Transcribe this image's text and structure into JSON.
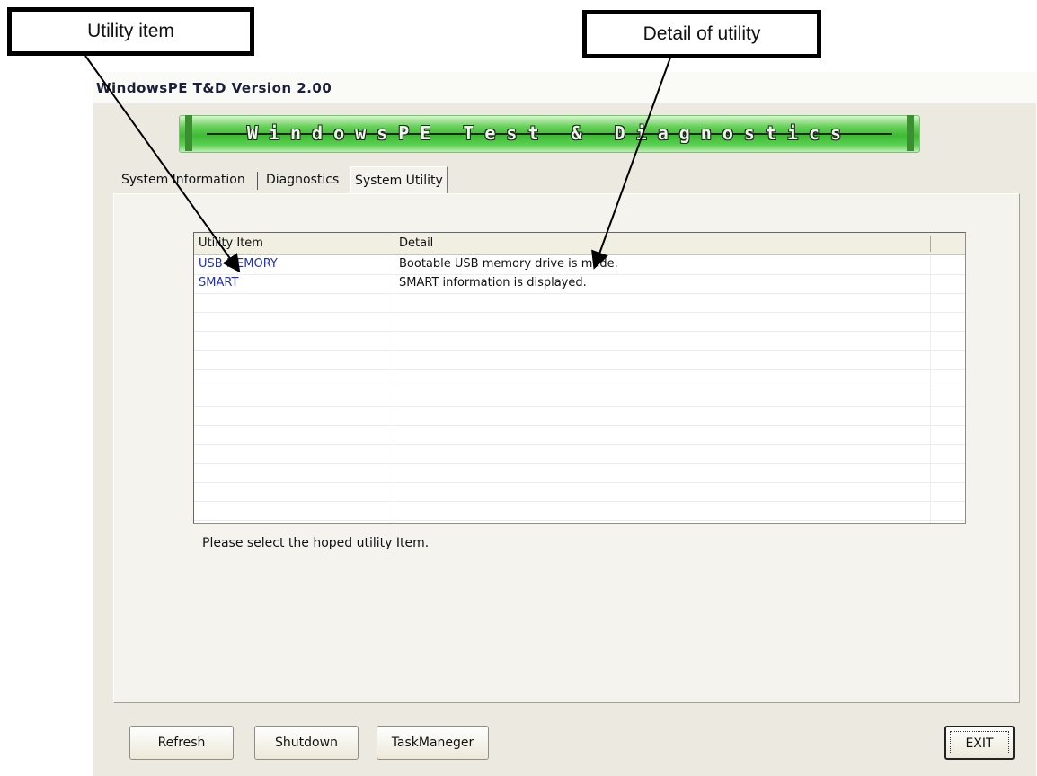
{
  "callouts": {
    "utility_item": "Utility item",
    "detail_of_utility": "Detail of utility"
  },
  "window": {
    "title": "WindowsPE T&D Version 2.00",
    "banner": "WindowsPE Test & Diagnostics"
  },
  "tabs": [
    {
      "label": "System Information",
      "active": false
    },
    {
      "label": "Diagnostics",
      "active": false
    },
    {
      "label": "System Utility",
      "active": true
    }
  ],
  "list": {
    "columns": [
      "Utility Item",
      "Detail"
    ],
    "rows": [
      {
        "item": "USB MEMORY",
        "detail": "Bootable USB memory drive is made."
      },
      {
        "item": "SMART",
        "detail": "SMART information is displayed."
      }
    ]
  },
  "hint": "Please select the hoped utility Item.",
  "buttons": {
    "refresh": "Refresh",
    "shutdown": "Shutdown",
    "taskmanager": "TaskManeger",
    "exit": "EXIT"
  }
}
